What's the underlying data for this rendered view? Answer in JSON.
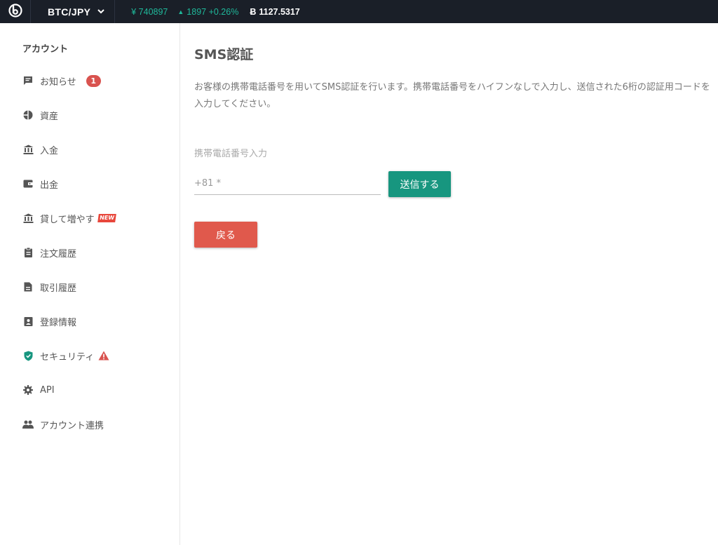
{
  "header": {
    "logo_icon": "bitbank-logo-icon",
    "pair": "BTC/JPY",
    "price": "¥ 740897",
    "change": "1897 +0.26%",
    "btc_value": "1127.5317",
    "btc_symbol": "Ƀ",
    "accent": "#1fb89a",
    "background": "#1a1f28"
  },
  "sidebar": {
    "heading": "アカウント",
    "items": [
      {
        "label": "お知らせ",
        "icon": "message-icon",
        "badge": "1"
      },
      {
        "label": "資産",
        "icon": "pie-chart-icon"
      },
      {
        "label": "入金",
        "icon": "bank-icon"
      },
      {
        "label": "出金",
        "icon": "wallet-icon"
      },
      {
        "label": "貸して増やす",
        "icon": "bank-icon",
        "badge": "NEW"
      },
      {
        "label": "注文履歴",
        "icon": "clipboard-icon"
      },
      {
        "label": "取引履歴",
        "icon": "document-icon"
      },
      {
        "label": "登録情報",
        "icon": "id-card-icon"
      },
      {
        "label": "セキュリティ",
        "icon": "shield-icon",
        "badge": "warning"
      },
      {
        "label": "API",
        "icon": "gear-icon"
      },
      {
        "label": "アカウント連携",
        "icon": "people-icon"
      }
    ]
  },
  "main": {
    "title": "SMS認証",
    "description": "お客様の携帯電話番号を用いてSMS認証を行います。携帯電話番号をハイフンなしで入力し、送信された6桁の認証用コードを入力してください。",
    "field_label": "携帯電話番号入力",
    "phone_placeholder": "+81 *",
    "send_button": "送信する",
    "back_button": "戻る",
    "send_color": "#17967f",
    "back_color": "#e0594c"
  }
}
